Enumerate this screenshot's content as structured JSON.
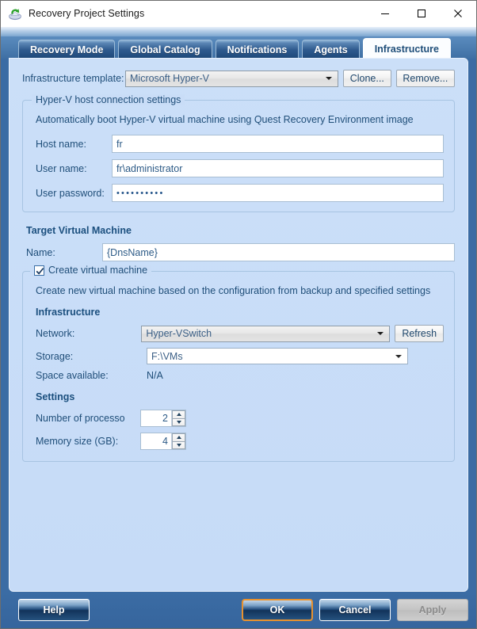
{
  "window": {
    "title": "Recovery Project Settings",
    "icon": "recovery-app-icon",
    "controls": {
      "minimize": "minimize-icon",
      "maximize": "maximize-icon",
      "close": "close-icon"
    }
  },
  "tabs": [
    {
      "label": "Recovery Mode",
      "active": false
    },
    {
      "label": "Global Catalog",
      "active": false
    },
    {
      "label": "Notifications",
      "active": false
    },
    {
      "label": "Agents",
      "active": false
    },
    {
      "label": "Infrastructure",
      "active": true
    }
  ],
  "template_row": {
    "label": "Infrastructure template:",
    "value": "Microsoft Hyper-V",
    "clone_label": "Clone...",
    "remove_label": "Remove..."
  },
  "host_group": {
    "title": "Hyper-V host connection settings",
    "description": "Automatically boot Hyper-V virtual machine using Quest Recovery Environment image",
    "fields": [
      {
        "label": "Host name:",
        "value": "fr"
      },
      {
        "label": "User name:",
        "value": "fr\\administrator"
      },
      {
        "label": "User password:",
        "value": "••••••••••"
      }
    ]
  },
  "target_vm": {
    "heading": "Target Virtual Machine",
    "name_label": "Name:",
    "name_value": "{DnsName}"
  },
  "create_vm": {
    "checkbox_label": "Create virtual machine",
    "checked": true,
    "description": "Create new virtual machine based on the configuration from backup and specified settings",
    "infrastructure_heading": "Infrastructure",
    "network_label": "Network:",
    "network_value": "Hyper-VSwitch",
    "refresh_label": "Refresh",
    "storage_label": "Storage:",
    "storage_value": "F:\\VMs",
    "space_label": "Space available:",
    "space_value": "N/A",
    "settings_heading": "Settings",
    "processors_label": "Number of processo",
    "processors_value": "2",
    "memory_label": "Memory size (GB):",
    "memory_value": "4"
  },
  "footer": {
    "help": "Help",
    "ok": "OK",
    "cancel": "Cancel",
    "apply": "Apply",
    "apply_disabled": true
  },
  "colors": {
    "accent": "#1f4e79",
    "panel_bg": "#c9ddf7",
    "frame": "#3b6ca4",
    "focus_ring": "#e8922f"
  }
}
